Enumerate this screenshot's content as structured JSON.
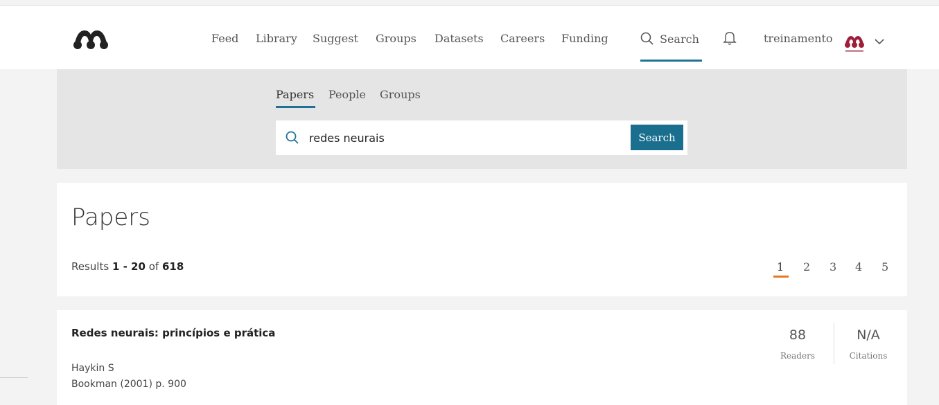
{
  "nav": {
    "items": [
      "Feed",
      "Library",
      "Suggest",
      "Groups",
      "Datasets",
      "Careers",
      "Funding"
    ],
    "search_label": "Search",
    "username": "treinamento"
  },
  "search_panel": {
    "tabs": [
      "Papers",
      "People",
      "Groups"
    ],
    "active_tab": "Papers",
    "query": "redes neurais",
    "button_label": "Search"
  },
  "papers": {
    "title": "Papers",
    "results_prefix": "Results",
    "results_range": "1 - 20",
    "results_of": "of",
    "results_total": "618",
    "pages": [
      "1",
      "2",
      "3",
      "4",
      "5"
    ],
    "current_page": "1"
  },
  "result": {
    "title": "Redes neurais: princípios e prática",
    "author": "Haykin S",
    "publication": "Bookman (2001) p. 900",
    "readers_value": "88",
    "readers_label": "Readers",
    "citations_value": "N/A",
    "citations_label": "Citations"
  },
  "colors": {
    "accent": "#1f7296",
    "search_button": "#1a6f8f",
    "page_active": "#e87722",
    "brand": "#9f1f3a"
  }
}
